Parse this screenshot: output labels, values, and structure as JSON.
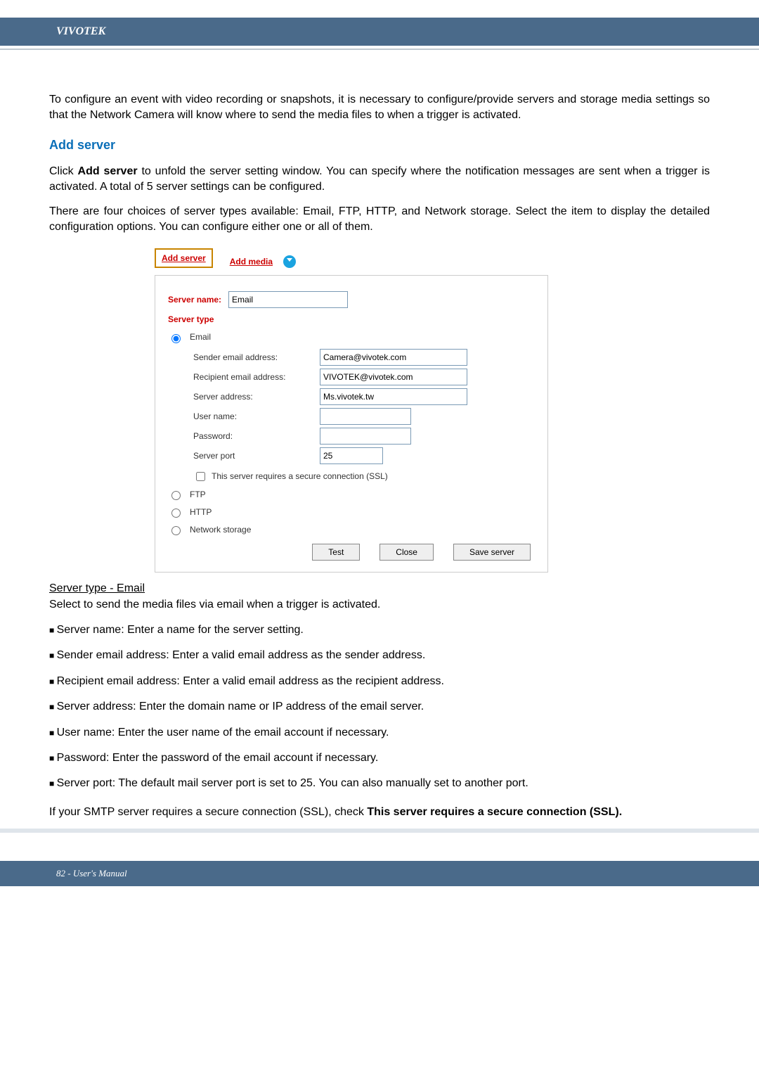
{
  "brand": "VIVOTEK",
  "intro": "To configure an event with video recording or snapshots, it is necessary to configure/provide servers and storage media settings so that the Network Camera will know where to send the media files to when a trigger is activated.",
  "section_title": "Add server",
  "para1": "Click Add server to unfold the server setting window. You can specify where the notification messages are sent when a trigger is activated. A total of 5 server settings can be configured.",
  "para2": "There are four choices of server types available: Email, FTP, HTTP, and Network storage. Select the item to display the detailed configuration options. You can configure either one or all of them.",
  "tabs": {
    "add_server": "Add server",
    "add_media": "Add media"
  },
  "form": {
    "server_name_label": "Server name:",
    "server_name_value": "Email",
    "server_type_label": "Server type",
    "radio_email": "Email",
    "sender_label": "Sender email address:",
    "sender_value": "Camera@vivotek.com",
    "recipient_label": "Recipient email address:",
    "recipient_value": "VIVOTEK@vivotek.com",
    "serveraddr_label": "Server address:",
    "serveraddr_value": "Ms.vivotek.tw",
    "username_label": "User name:",
    "username_value": "",
    "password_label": "Password:",
    "password_value": "",
    "port_label": "Server port",
    "port_value": "25",
    "ssl_label": "This server requires a secure connection (SSL)",
    "radio_ftp": "FTP",
    "radio_http": "HTTP",
    "radio_ns": "Network storage",
    "btn_test": "Test",
    "btn_close": "Close",
    "btn_save": "Save server"
  },
  "subsection_title": "Server type - Email",
  "subsection_desc": "Select to send the media files via email when a trigger is activated.",
  "bullets": [
    "Server name: Enter a name for the server setting.",
    "Sender email address: Enter a valid email address as the sender address.",
    "Recipient email address: Enter a valid email address as the recipient address.",
    "Server address: Enter the domain name or IP address of the email server.",
    "User name: Enter the user name of the email account if necessary.",
    "Password: Enter the password of the email account if necessary.",
    "Server port: The default mail server port is set to 25. You can also manually set to another port."
  ],
  "ssl_note_a": "If your SMTP server requires a secure connection (SSL), check ",
  "ssl_note_b": "This server requires a secure connection (SSL).",
  "footer": "82 - User's Manual"
}
